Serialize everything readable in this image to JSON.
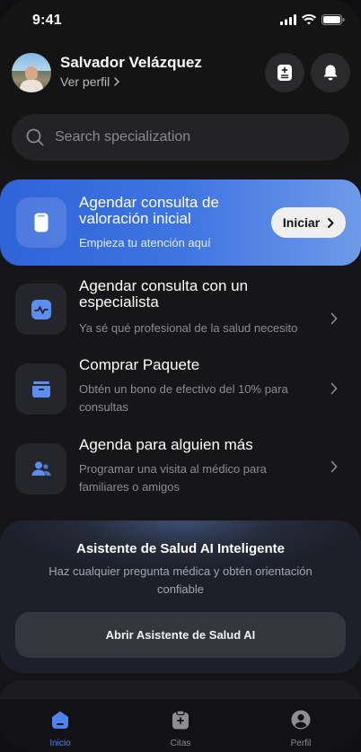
{
  "status_bar": {
    "time": "9:41"
  },
  "header": {
    "user_name": "Salvador Velázquez",
    "profile_link": "Ver perfil",
    "search_placeholder": "Search specialization"
  },
  "hero": {
    "title": "Agendar consulta de valoración inicial",
    "subtitle": "Empieza tu atención aquí",
    "button_label": "Iniciar"
  },
  "options": [
    {
      "title": "Agendar consulta con un especialista",
      "subtitle": "Ya sé qué profesional de la salud necesito",
      "icon": "health-chart-icon"
    },
    {
      "title": "Comprar Paquete",
      "subtitle": "Obtén un bono de efectivo del 10% para consultas",
      "icon": "package-icon"
    },
    {
      "title": "Agenda para alguien más",
      "subtitle": "Programar una visita al médico para familiares o amigos",
      "icon": "users-icon"
    }
  ],
  "ai_assistant": {
    "title": "Asistente de Salud AI Inteligente",
    "subtitle": "Haz cualquier pregunta médica y obtén orientación confiable",
    "button_label": "Abrir Asistente de Salud AI"
  },
  "tabbar": {
    "items": [
      {
        "label": "Inicio",
        "icon": "home-icon",
        "active": true
      },
      {
        "label": "Citas",
        "icon": "clipboard-icon",
        "active": false
      },
      {
        "label": "Perfil",
        "icon": "user-icon",
        "active": false
      }
    ]
  },
  "colors": {
    "accent": "#4f84f0",
    "hero_gradient_start": "#2f63d8",
    "hero_gradient_end": "#6e9ae8",
    "background": "#151517"
  }
}
